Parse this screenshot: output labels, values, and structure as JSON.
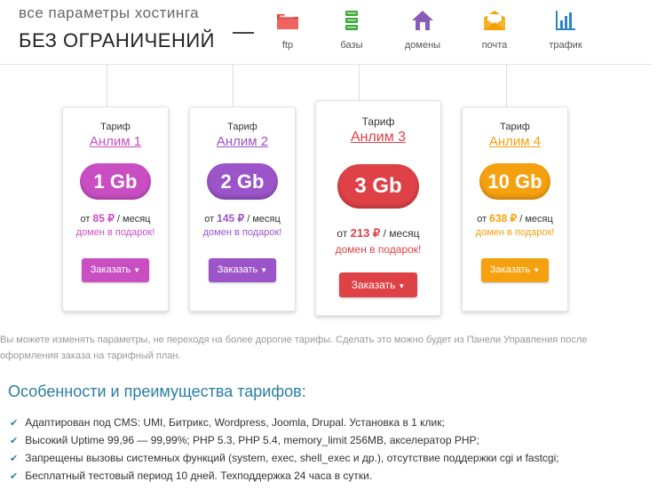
{
  "header": {
    "subtitle": "все параметры хостинга",
    "headline": "БЕЗ ОГРАНИЧЕНИЙ"
  },
  "features": [
    {
      "label": "ftp",
      "icon": "folder-icon",
      "color": "#e8433f"
    },
    {
      "label": "базы",
      "icon": "database-icon",
      "color": "#3ea83c"
    },
    {
      "label": "домены",
      "icon": "house-icon",
      "color": "#8a5cb8"
    },
    {
      "label": "почта",
      "icon": "mail-icon",
      "color": "#f5a000"
    },
    {
      "label": "трафик",
      "icon": "chart-icon",
      "color": "#2d86c9"
    }
  ],
  "plans": [
    {
      "tariff_label": "Тариф",
      "name": "Анлим 1",
      "size": "1 Gb",
      "price_prefix": "от",
      "price": "85 ₽",
      "price_suffix": "/ месяц",
      "gift": "домен в подарок!",
      "button": "Заказать",
      "color": "#c94ec2"
    },
    {
      "tariff_label": "Тариф",
      "name": "Анлим 2",
      "size": "2 Gb",
      "price_prefix": "от",
      "price": "145 ₽",
      "price_suffix": "/ месяц",
      "gift": "домен в подарок!",
      "button": "Заказать",
      "color": "#9c54c9"
    },
    {
      "tariff_label": "Тариф",
      "name": "Анлим 3",
      "size": "3 Gb",
      "price_prefix": "от",
      "price": "213 ₽",
      "price_suffix": "/ месяц",
      "gift": "домен в подарок!",
      "button": "Заказать",
      "color": "#de4146"
    },
    {
      "tariff_label": "Тариф",
      "name": "Анлим 4",
      "size": "10 Gb",
      "price_prefix": "от",
      "price": "638 ₽",
      "price_suffix": "/ месяц",
      "gift": "домен в подарок!",
      "button": "Заказать",
      "color": "#f5a00f"
    }
  ],
  "notice": "Вы можете изменять параметры, не переходя на более дорогие тарифы. Сделать это можно будет из Панели Управления после оформления заказа на тарифный план.",
  "advantages": {
    "title": "Особенности и преимущества тарифов:",
    "items": [
      "Адаптирован под CMS: UMI, Битрикс, Wordpress, Joomla, Drupal. Установка в 1 клик;",
      "Высокий Uptime 99,96 — 99,99%; PHP 5.3, PHP 5.4, memory_limit 256MB, акселератор PHP;",
      "Запрещены вызовы системных функций (system, exec, shell_exec и др.), отсутствие поддержки cgi и fastcgi;",
      "Бесплатный тестовый период 10 дней. Техподдержка 24 часа в сутки."
    ]
  }
}
